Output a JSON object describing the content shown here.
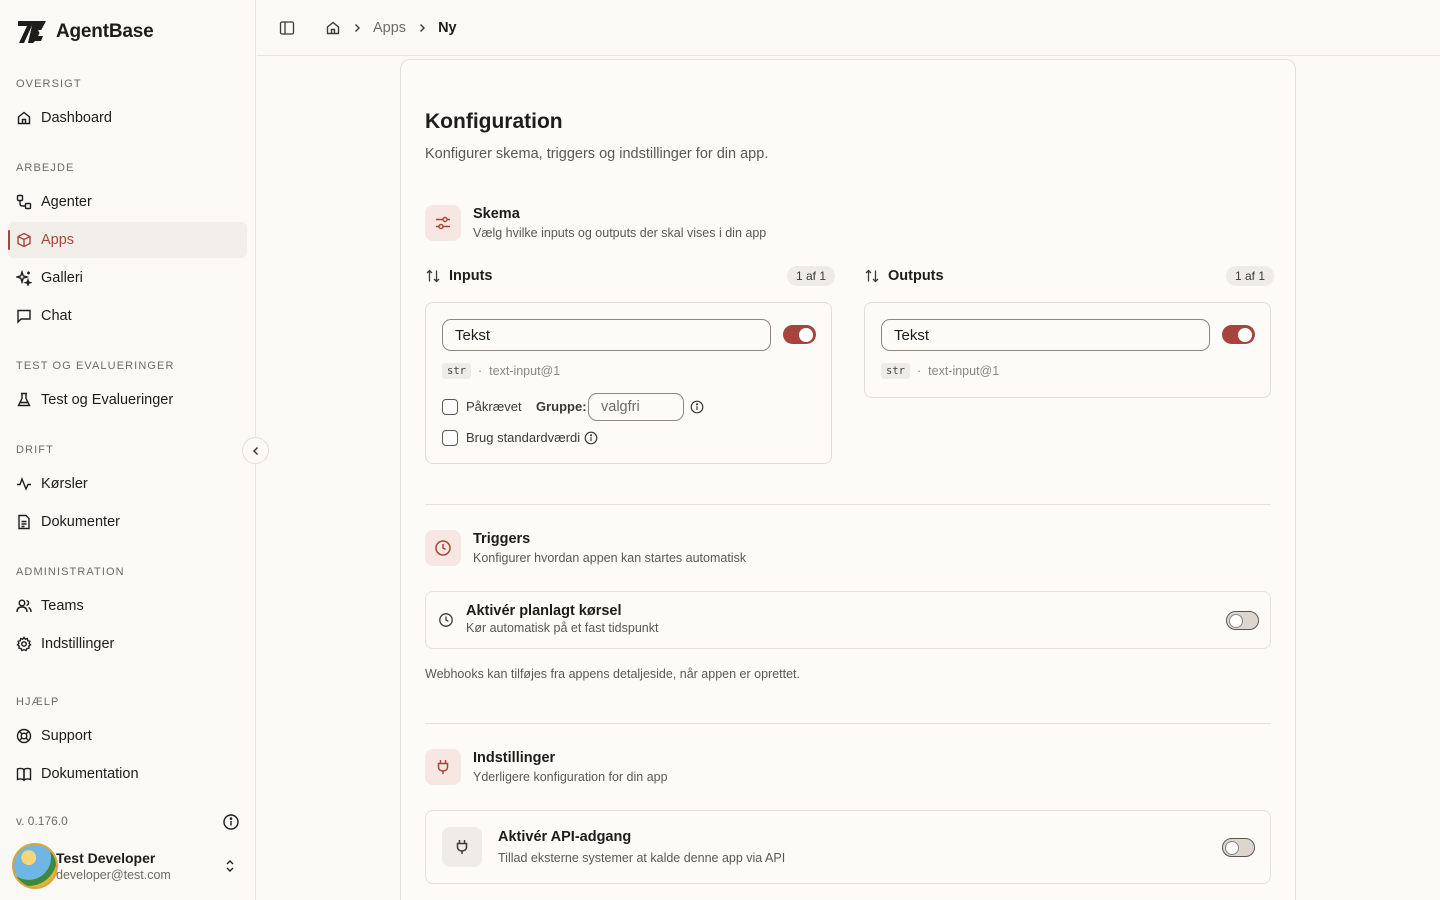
{
  "app": {
    "name": "AgentBase"
  },
  "sidebar": {
    "sections": [
      {
        "label": "OVERSIGT"
      },
      {
        "label": "ARBEJDE"
      },
      {
        "label": "TEST OG EVALUERINGER"
      },
      {
        "label": "DRIFT"
      },
      {
        "label": "ADMINISTRATION"
      },
      {
        "label": "HJÆLP"
      }
    ],
    "items": [
      {
        "label": "Dashboard",
        "icon": "home-icon"
      },
      {
        "label": "Agenter",
        "icon": "workflow-icon"
      },
      {
        "label": "Apps",
        "icon": "box-icon",
        "active": true
      },
      {
        "label": "Galleri",
        "icon": "sparkles-icon"
      },
      {
        "label": "Chat",
        "icon": "message-icon"
      },
      {
        "label": "Test og Evalueringer",
        "icon": "flask-icon"
      },
      {
        "label": "Kørsler",
        "icon": "activity-icon"
      },
      {
        "label": "Dokumenter",
        "icon": "file-icon"
      },
      {
        "label": "Teams",
        "icon": "users-icon"
      },
      {
        "label": "Indstillinger",
        "icon": "gear-icon"
      },
      {
        "label": "Support",
        "icon": "lifebuoy-icon"
      },
      {
        "label": "Dokumentation",
        "icon": "book-icon"
      }
    ],
    "version": "v. 0.176.0",
    "user": {
      "name": "Test Developer",
      "email": "developer@test.com"
    }
  },
  "breadcrumb": {
    "apps": "Apps",
    "current": "Ny"
  },
  "main": {
    "title": "Konfiguration",
    "subtitle": "Konfigurer skema, triggers og indstillinger for din app.",
    "schema": {
      "title": "Skema",
      "subtitle": "Vælg hvilke inputs og outputs der skal vises i din app",
      "inputs": {
        "label": "Inputs",
        "count": "1 af 1",
        "field": {
          "name": "Tekst",
          "enabled": true,
          "type": "str",
          "component": "text-input@1",
          "required_label": "Påkrævet",
          "group_label": "Gruppe:",
          "group_placeholder": "valgfri",
          "default_label": "Brug standardværdi"
        }
      },
      "outputs": {
        "label": "Outputs",
        "count": "1 af 1",
        "field": {
          "name": "Tekst",
          "enabled": true,
          "type": "str",
          "component": "text-input@1"
        }
      }
    },
    "triggers": {
      "title": "Triggers",
      "subtitle": "Konfigurer hvordan appen kan startes automatisk",
      "schedule_title": "Aktivér planlagt kørsel",
      "schedule_sub": "Kør automatisk på et fast tidspunkt",
      "schedule_enabled": false,
      "note": "Webhooks kan tilføjes fra appens detaljeside, når appen er oprettet."
    },
    "settings": {
      "title": "Indstillinger",
      "subtitle": "Yderligere konfiguration for din app",
      "api_title": "Aktivér API-adgang",
      "api_sub": "Tillad eksterne systemer at kalde denne app via API",
      "api_enabled": false
    }
  },
  "colors": {
    "accent": "#a7453c",
    "background": "#fbf9f6"
  }
}
